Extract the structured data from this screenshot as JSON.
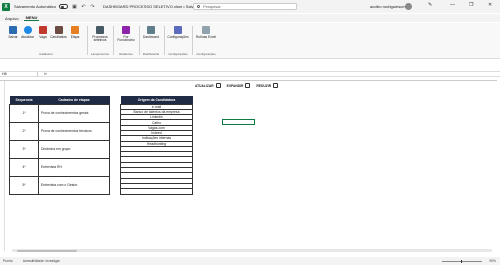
{
  "titlebar": {
    "autosave_label": "Salvamento Automático",
    "doc_title": "DASHBOARD PROCESSO SELETIVO.xlsm • Salvo",
    "search_placeholder": "Pesquisar",
    "user": "acolito rodriguiescmb"
  },
  "menu": {
    "tabs": [
      {
        "label": "Arquivo"
      },
      {
        "label": "MENU"
      }
    ]
  },
  "ribbon": {
    "buttons": [
      {
        "label": "Salvar",
        "icon": "save-icon"
      },
      {
        "label": "Atualizar",
        "icon": "refresh-icon"
      },
      {
        "label": "Vaga",
        "icon": "vacancy-icon"
      },
      {
        "label": "Candidatos",
        "icon": "candidates-icon"
      },
      {
        "label": "Etapa",
        "icon": "stage-icon"
      },
      {
        "label": "Processos seletivos",
        "icon": "processes-icon"
      },
      {
        "label": "Por Funcionário",
        "icon": "employee-icon"
      },
      {
        "label": "Dashboard",
        "icon": "dashboard-icon"
      },
      {
        "label": "Configurações",
        "icon": "settings-icon"
      },
      {
        "label": "Rotinas Excel",
        "icon": "routines-icon"
      }
    ],
    "groups": [
      {
        "label": "Cadastros"
      },
      {
        "label": "Lançamentos"
      },
      {
        "label": "Relatórios"
      },
      {
        "label": "Dashboards"
      },
      {
        "label": "Configurações"
      },
      {
        "label": "Configurações"
      }
    ],
    "colors": {
      "save": "#2b6cb0",
      "refresh": "#1e88e5",
      "vacancy": "#c0392b",
      "candidates": "#6d4c41",
      "stage": "#e67e22",
      "processes": "#455a64",
      "employee": "#8e24aa",
      "dashboard": "#607d8b",
      "settings": "#5c6bc0",
      "routines": "#90a4ae"
    }
  },
  "formula": {
    "cell_ref": "H8",
    "fx": "fx"
  },
  "actions": [
    {
      "label": "ATUALIZAR"
    },
    {
      "label": "EXPANDIR"
    },
    {
      "label": "REDUZIR"
    }
  ],
  "stages_table": {
    "headers": [
      "Sequencia",
      "Cadastro de etapas"
    ],
    "rows": [
      {
        "seq": "1º",
        "step": "Prova de conhecimentos gerais"
      },
      {
        "seq": "2º",
        "step": "Prova de conhecimentos técnicos"
      },
      {
        "seq": "3º",
        "step": "Dinâmica em grupo"
      },
      {
        "seq": "4º",
        "step": "Entrevista RH"
      },
      {
        "seq": "5º",
        "step": "Entrevista com o Gestor"
      }
    ]
  },
  "origin_table": {
    "header": "Origem da Candidatura",
    "rows": [
      "e-mail",
      "Banco de talentos da empresa",
      "Linkedin",
      "Catho",
      "Vagas.com",
      "Indeed",
      "Indicações internas",
      "Headhunting",
      "",
      "",
      "",
      "",
      "",
      "",
      "",
      "",
      ""
    ]
  },
  "statusbar": {
    "mode": "Pronto",
    "accessibility": "Acessibilidade: investigar",
    "zoom": "90%"
  }
}
